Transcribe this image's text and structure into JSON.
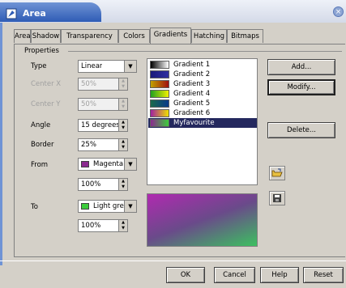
{
  "window": {
    "title": "Area",
    "close_glyph": "×",
    "icon": "area-icon"
  },
  "tabs": [
    "Area",
    "Shadow",
    "Transparency",
    "Colors",
    "Gradients",
    "Hatching",
    "Bitmaps"
  ],
  "active_tab": "Gradients",
  "properties": {
    "group_label": "Properties",
    "type": {
      "label": "Type",
      "value": "Linear"
    },
    "center_x": {
      "label": "Center X",
      "value": "50%"
    },
    "center_y": {
      "label": "Center Y",
      "value": "50%"
    },
    "angle": {
      "label": "Angle",
      "value": "15 degrees"
    },
    "border": {
      "label": "Border",
      "value": "25%"
    },
    "from": {
      "label": "From",
      "color_name": "Magenta",
      "color": "#8b2a8f",
      "percent": "100%"
    },
    "to": {
      "label": "To",
      "color_name": "Light gree",
      "color": "#3bcc3b",
      "percent": "100%"
    }
  },
  "gradients": [
    {
      "name": "Gradient 1",
      "c1": "#000000",
      "c2": "#ffffff"
    },
    {
      "name": "Gradient 2",
      "c1": "#1a1a7a",
      "c2": "#3030a0"
    },
    {
      "name": "Gradient 3",
      "c1": "#c0a000",
      "c2": "#a01010"
    },
    {
      "name": "Gradient 4",
      "c1": "#20a020",
      "c2": "#f0f000"
    },
    {
      "name": "Gradient 5",
      "c1": "#1a6a4a",
      "c2": "#0a3a8a"
    },
    {
      "name": "Gradient 6",
      "c1": "#a020a0",
      "c2": "#f0e000"
    },
    {
      "name": "Myfavourite",
      "c1": "#8b2a8f",
      "c2": "#3bcc3b"
    }
  ],
  "selected_gradient": 6,
  "buttons": {
    "add": "Add...",
    "modify": "Modify...",
    "delete": "Delete...",
    "ok": "OK",
    "cancel": "Cancel",
    "help": "Help",
    "reset": "Reset"
  },
  "icons": {
    "load": "open-folder-icon",
    "save": "save-icon"
  }
}
